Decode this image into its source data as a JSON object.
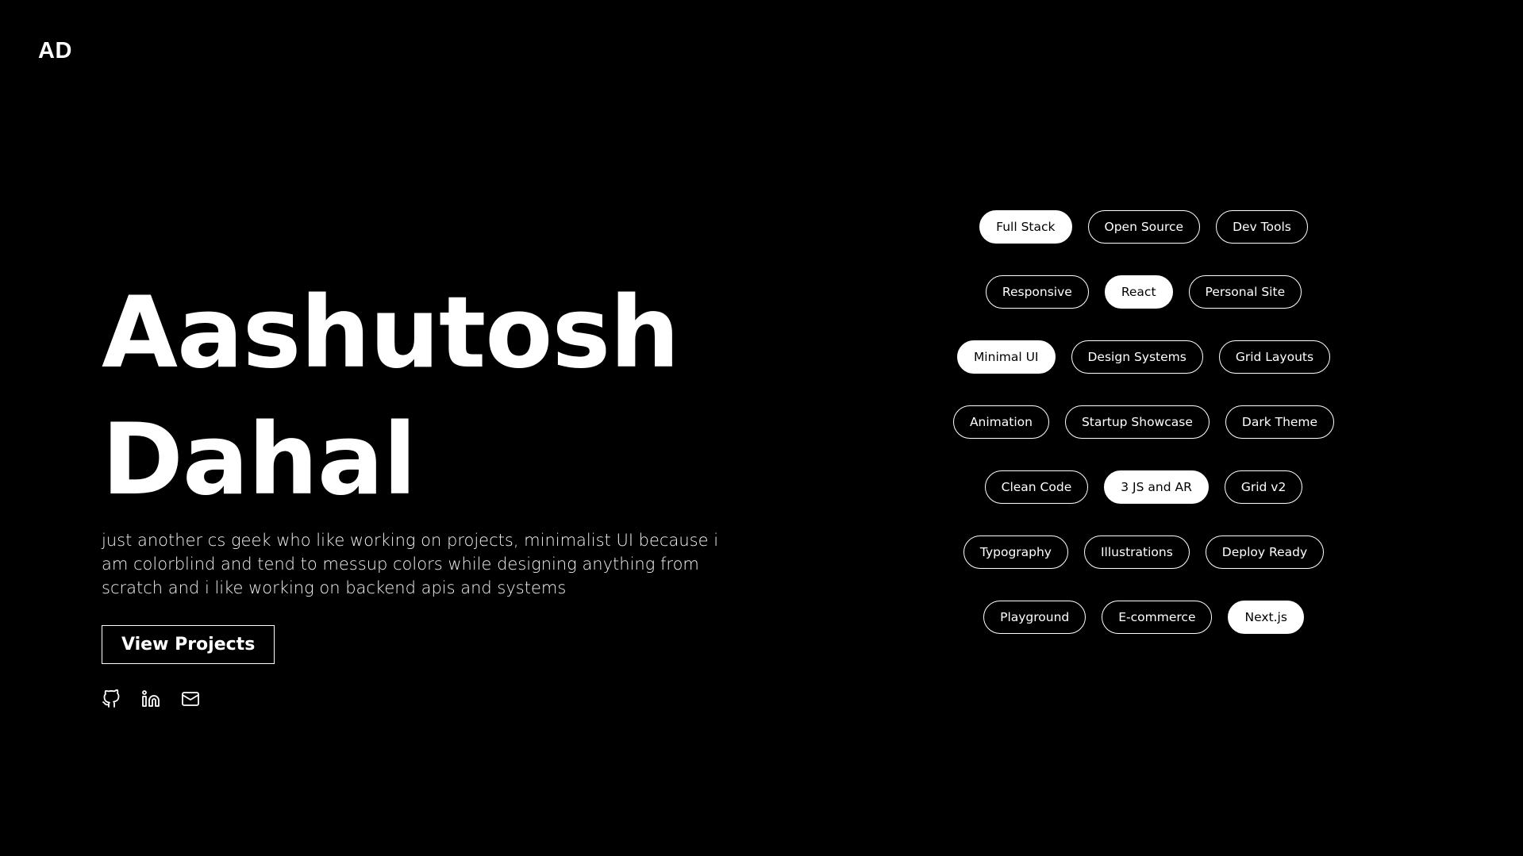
{
  "logo": "AD",
  "hero": {
    "first_name": "Aashutosh",
    "last_name": "Dahal",
    "bio": "just another cs geek who like working on projects, minimalist UI because i am colorblind and tend to messup colors while designing anything from scratch and i like working on backend apis and systems",
    "cta_label": "View Projects"
  },
  "socials": [
    {
      "icon": "github-icon"
    },
    {
      "icon": "linkedin-icon"
    },
    {
      "icon": "mail-icon"
    }
  ],
  "tags": [
    [
      {
        "label": "Full Stack",
        "active": true
      },
      {
        "label": "Open Source",
        "active": false
      },
      {
        "label": "Dev Tools",
        "active": false
      }
    ],
    [
      {
        "label": "Responsive",
        "active": false
      },
      {
        "label": "React",
        "active": true
      },
      {
        "label": "Personal Site",
        "active": false
      }
    ],
    [
      {
        "label": "Minimal UI",
        "active": true
      },
      {
        "label": "Design Systems",
        "active": false
      },
      {
        "label": "Grid Layouts",
        "active": false
      }
    ],
    [
      {
        "label": "Animation",
        "active": false
      },
      {
        "label": "Startup Showcase",
        "active": false
      },
      {
        "label": "Dark Theme",
        "active": false
      }
    ],
    [
      {
        "label": "Clean Code",
        "active": false
      },
      {
        "label": "3 JS and AR",
        "active": true
      },
      {
        "label": "Grid v2",
        "active": false
      }
    ],
    [
      {
        "label": "Typography",
        "active": false
      },
      {
        "label": "Illustrations",
        "active": false
      },
      {
        "label": "Deploy Ready",
        "active": false
      }
    ],
    [
      {
        "label": "Playground",
        "active": false
      },
      {
        "label": "E-commerce",
        "active": false
      },
      {
        "label": "Next.js",
        "active": true
      }
    ]
  ],
  "colors": {
    "background": "#000000",
    "foreground": "#ffffff"
  }
}
